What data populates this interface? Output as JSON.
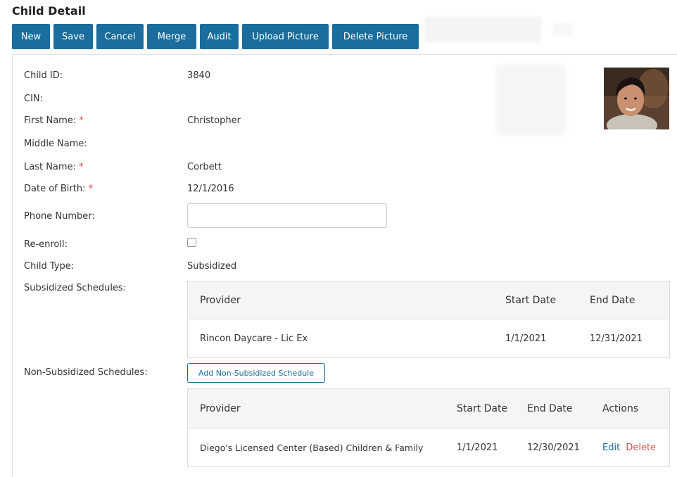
{
  "page": {
    "title": "Child Detail"
  },
  "toolbar": {
    "new": "New",
    "save": "Save",
    "cancel": "Cancel",
    "merge": "Merge",
    "audit": "Audit",
    "upload_picture": "Upload Picture",
    "delete_picture": "Delete Picture"
  },
  "form": {
    "child_id": {
      "label": "Child ID:",
      "value": "3840"
    },
    "cin": {
      "label": "CIN:",
      "value": ""
    },
    "first_name": {
      "label": "First Name:",
      "required": "*",
      "value": "Christopher"
    },
    "middle_name": {
      "label": "Middle Name:",
      "value": ""
    },
    "last_name": {
      "label": "Last Name:",
      "required": "*",
      "value": "Corbett"
    },
    "dob": {
      "label": "Date of Birth:",
      "required": "*",
      "value": "12/1/2016"
    },
    "phone": {
      "label": "Phone Number:",
      "value": "",
      "placeholder": ""
    },
    "reenroll": {
      "label": "Re-enroll:",
      "checked": false
    },
    "child_type": {
      "label": "Child Type:",
      "value": "Subsidized"
    }
  },
  "subsidized": {
    "label": "Subsidized Schedules:",
    "headers": {
      "provider": "Provider",
      "start": "Start Date",
      "end": "End Date"
    },
    "rows": [
      {
        "provider": "Rincon Daycare - Lic Ex",
        "start": "1/1/2021",
        "end": "12/31/2021"
      }
    ]
  },
  "nonsubsidized": {
    "label": "Non-Subsidized Schedules:",
    "add_button": "Add Non-Subsidized Schedule",
    "headers": {
      "provider": "Provider",
      "start": "Start Date",
      "end": "End Date",
      "actions": "Actions"
    },
    "rows": [
      {
        "provider": "Diego's Licensed Center (Based) Children & Family",
        "start": "1/1/2021",
        "end": "12/30/2021",
        "edit": "Edit",
        "delete": "Delete"
      }
    ]
  },
  "colors": {
    "primary": "#1a6d9c",
    "danger": "#d9534f",
    "header_bg": "#f5f5f5"
  }
}
